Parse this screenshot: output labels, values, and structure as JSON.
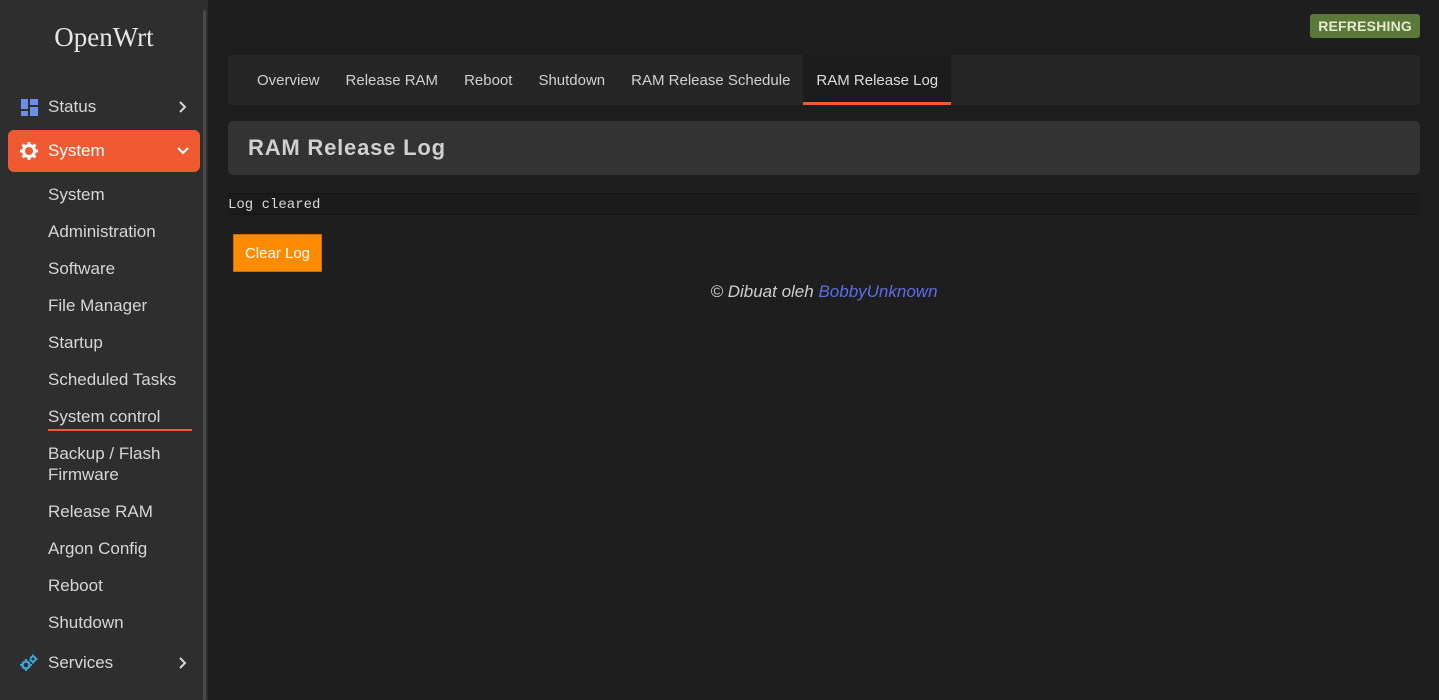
{
  "app": {
    "brand": "OpenWrt",
    "status_badge": "REFRESHING"
  },
  "sidebar": {
    "items": [
      {
        "label": "Status",
        "icon": "dashboard-icon"
      },
      {
        "label": "System",
        "icon": "gear-icon"
      },
      {
        "label": "Services",
        "icon": "gears-icon"
      }
    ],
    "system_submenu": [
      "System",
      "Administration",
      "Software",
      "File Manager",
      "Startup",
      "Scheduled Tasks",
      "System control",
      "Backup / Flash Firmware",
      "Release RAM",
      "Argon Config",
      "Reboot",
      "Shutdown"
    ]
  },
  "tabs": [
    "Overview",
    "Release RAM",
    "Reboot",
    "Shutdown",
    "RAM Release Schedule",
    "RAM Release Log"
  ],
  "page": {
    "title": "RAM Release Log",
    "log_text": "Log cleared",
    "clear_button": "Clear Log"
  },
  "footer": {
    "prefix": "© Dibuat oleh",
    "author": "BobbyUnknown"
  },
  "colors": {
    "accent": "#f05a32",
    "button": "#ff8c00",
    "badge": "#5b7a3a",
    "link": "#5b6ee6"
  }
}
